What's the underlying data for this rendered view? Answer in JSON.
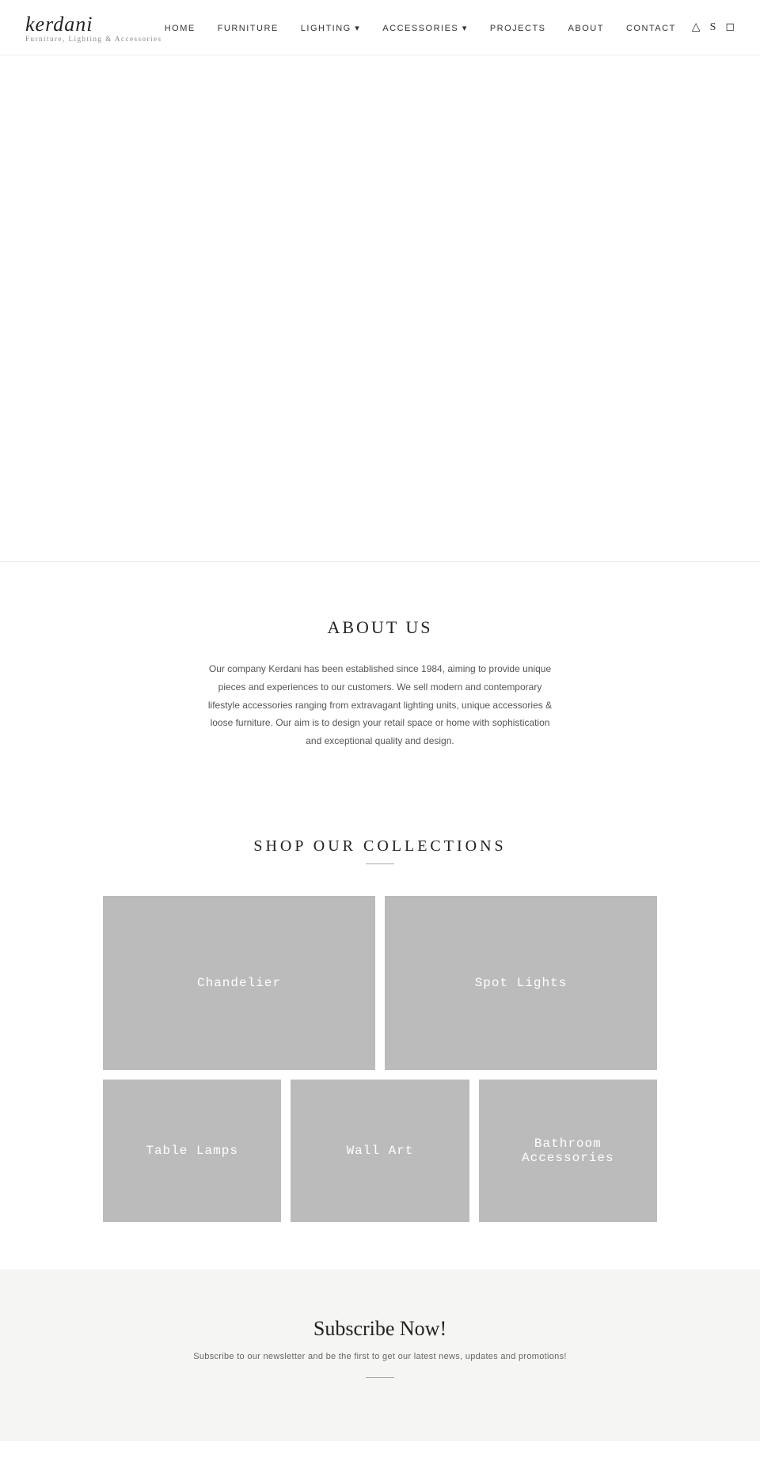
{
  "nav": {
    "logo": "kerdani",
    "logo_sub": "Furniture, Lighting & Accessories",
    "links": [
      {
        "label": "HOME",
        "id": "home"
      },
      {
        "label": "FURNITURE",
        "id": "furniture"
      },
      {
        "label": "LIGHTING ▾",
        "id": "lighting"
      },
      {
        "label": "ACCESSORIES ▾",
        "id": "accessories"
      },
      {
        "label": "PROJECTS",
        "id": "projects"
      },
      {
        "label": "ABOUT",
        "id": "about"
      },
      {
        "label": "CONTACT",
        "id": "contact"
      }
    ],
    "icons": [
      "search",
      "wishlist",
      "cart"
    ]
  },
  "about": {
    "title": "ABOUT US",
    "body": "Our company Kerdani has been established since 1984, aiming to provide unique pieces and experiences to our customers. We sell modern and contemporary lifestyle accessories ranging from extravagant lighting units, unique accessories & loose furniture. Our aim is to design your retail space or home with sophistication and exceptional quality and design."
  },
  "shop": {
    "title": "SHOP OUR COLLECTIONS",
    "collections_top": [
      {
        "label": "Chandelier",
        "id": "chandelier"
      },
      {
        "label": "Spot Lights",
        "id": "spot-lights"
      }
    ],
    "collections_bottom": [
      {
        "label": "Table Lamps",
        "id": "table-lamps"
      },
      {
        "label": "Wall Art",
        "id": "wall-art"
      },
      {
        "label": "Bathroom Accessories",
        "id": "bathroom-accessories"
      }
    ]
  },
  "subscribe": {
    "title": "Subscribe Now!",
    "body": "Subscribe to our newsletter and be the first to get our latest news, updates and promotions!"
  }
}
